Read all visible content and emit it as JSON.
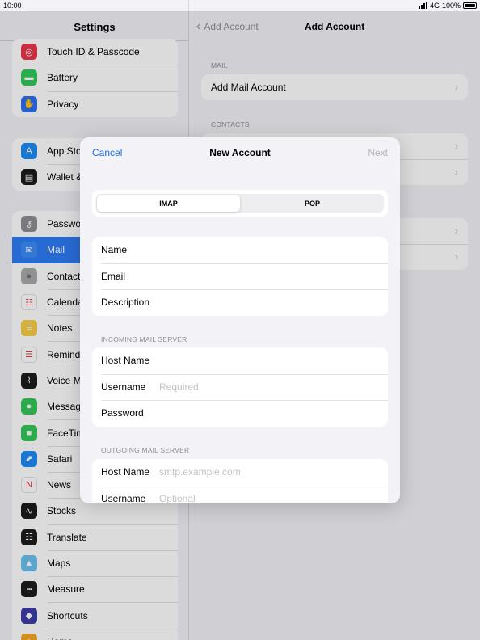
{
  "status": {
    "time": "10:00",
    "network": "4G",
    "battery": "100%"
  },
  "sidebar": {
    "title": "Settings",
    "groups": [
      {
        "items": [
          {
            "label": "Touch ID & Passcode",
            "icon": "fingerprint-icon",
            "color": "#e8364b"
          },
          {
            "label": "Battery",
            "icon": "battery-icon",
            "color": "#34c759"
          },
          {
            "label": "Privacy",
            "icon": "hand-icon",
            "color": "#2f6ff0"
          }
        ]
      },
      {
        "items": [
          {
            "label": "App Store",
            "icon": "app-store-icon",
            "color": "#1e8bf5"
          },
          {
            "label": "Wallet & Apple Pay",
            "icon": "wallet-icon",
            "color": "#1c1c1e"
          }
        ]
      },
      {
        "items": [
          {
            "label": "Passwords",
            "icon": "key-icon",
            "color": "#8e8e93"
          },
          {
            "label": "Mail",
            "icon": "envelope-icon",
            "color": "#3b8cf7",
            "selected": true
          },
          {
            "label": "Contacts",
            "icon": "contacts-icon",
            "color": "#a9a9ad"
          },
          {
            "label": "Calendar",
            "icon": "calendar-icon",
            "color": "#ffffff"
          },
          {
            "label": "Notes",
            "icon": "notes-icon",
            "color": "#f7ce46"
          },
          {
            "label": "Reminders",
            "icon": "reminders-icon",
            "color": "#ffffff"
          },
          {
            "label": "Voice Memos",
            "icon": "waveform-icon",
            "color": "#1c1c1e"
          },
          {
            "label": "Messages",
            "icon": "message-bubble-icon",
            "color": "#34c759"
          },
          {
            "label": "FaceTime",
            "icon": "video-camera-icon",
            "color": "#34c759"
          },
          {
            "label": "Safari",
            "icon": "compass-icon",
            "color": "#1e8bf5"
          },
          {
            "label": "News",
            "icon": "news-icon",
            "color": "#ffffff"
          },
          {
            "label": "Stocks",
            "icon": "stocks-icon",
            "color": "#1c1c1e"
          },
          {
            "label": "Translate",
            "icon": "translate-icon",
            "color": "#1c1c1e"
          },
          {
            "label": "Maps",
            "icon": "map-icon",
            "color": "#6cc0f2"
          },
          {
            "label": "Measure",
            "icon": "ruler-icon",
            "color": "#1c1c1e"
          },
          {
            "label": "Shortcuts",
            "icon": "shortcuts-icon",
            "color": "#3d3da8"
          },
          {
            "label": "Home",
            "icon": "house-icon",
            "color": "#f5a623"
          }
        ]
      }
    ]
  },
  "detail": {
    "back_label": "Add Account",
    "title": "Add Account",
    "mail_section": "MAIL",
    "add_mail_account": "Add Mail Account",
    "contacts_section": "CONTACTS"
  },
  "modal": {
    "cancel": "Cancel",
    "title": "New Account",
    "next": "Next",
    "segments": [
      "IMAP",
      "POP"
    ],
    "active_segment": "IMAP",
    "account": {
      "name_label": "Name",
      "email_label": "Email",
      "description_label": "Description"
    },
    "incoming": {
      "header": "INCOMING MAIL SERVER",
      "host_label": "Host Name",
      "username_label": "Username",
      "username_placeholder": "Required",
      "password_label": "Password"
    },
    "outgoing": {
      "header": "OUTGOING MAIL SERVER",
      "host_label": "Host Name",
      "host_placeholder": "smtp.example.com",
      "username_label": "Username",
      "username_placeholder": "Optional"
    }
  },
  "colors": {
    "accent": "#1a73e8",
    "selected_row": "#2f7cf6"
  }
}
